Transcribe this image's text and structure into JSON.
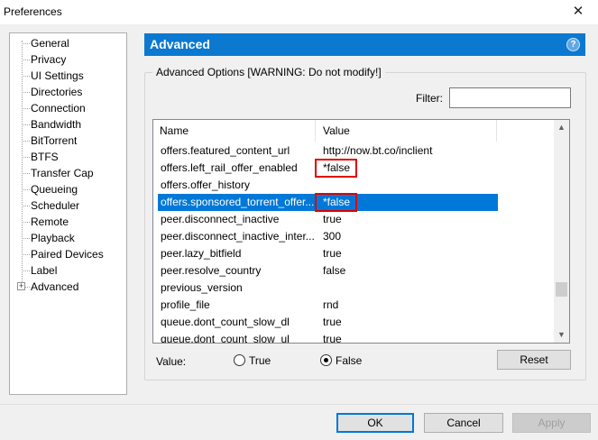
{
  "window": {
    "title": "Preferences",
    "close_glyph": "✕"
  },
  "sidebar": {
    "items": [
      {
        "label": "General"
      },
      {
        "label": "Privacy"
      },
      {
        "label": "UI Settings"
      },
      {
        "label": "Directories"
      },
      {
        "label": "Connection"
      },
      {
        "label": "Bandwidth"
      },
      {
        "label": "BitTorrent"
      },
      {
        "label": "BTFS"
      },
      {
        "label": "Transfer Cap"
      },
      {
        "label": "Queueing"
      },
      {
        "label": "Scheduler"
      },
      {
        "label": "Remote"
      },
      {
        "label": "Playback"
      },
      {
        "label": "Paired Devices"
      },
      {
        "label": "Label"
      },
      {
        "label": "Advanced",
        "expander": "+"
      }
    ]
  },
  "panel": {
    "title": "Advanced",
    "help_glyph": "?",
    "group_label": "Advanced Options [WARNING: Do not modify!]",
    "filter_label": "Filter:",
    "filter_value": ""
  },
  "list": {
    "columns": [
      "Name",
      "Value"
    ],
    "rows": [
      {
        "name": "offers.featured_content_url",
        "value": "http://now.bt.co/inclient"
      },
      {
        "name": "offers.left_rail_offer_enabled",
        "value": "*false",
        "highlighted": true
      },
      {
        "name": "offers.offer_history",
        "value": ""
      },
      {
        "name": "offers.sponsored_torrent_offer...",
        "value": "*false",
        "selected": true,
        "highlighted": true
      },
      {
        "name": "peer.disconnect_inactive",
        "value": "true"
      },
      {
        "name": "peer.disconnect_inactive_inter...",
        "value": "300"
      },
      {
        "name": "peer.lazy_bitfield",
        "value": "true"
      },
      {
        "name": "peer.resolve_country",
        "value": "false"
      },
      {
        "name": "previous_version",
        "value": ""
      },
      {
        "name": "profile_file",
        "value": "rnd"
      },
      {
        "name": "queue.dont_count_slow_dl",
        "value": "true"
      },
      {
        "name": "queue.dont_count_slow_ul",
        "value": "true"
      }
    ],
    "scroll_up_glyph": "▲",
    "scroll_down_glyph": "▼"
  },
  "value_editor": {
    "label": "Value:",
    "options": [
      "True",
      "False"
    ],
    "selected": "False",
    "reset_label": "Reset"
  },
  "footer": {
    "ok_label": "OK",
    "cancel_label": "Cancel",
    "apply_label": "Apply",
    "apply_enabled": false
  },
  "colors": {
    "header_bg": "#0b79d0",
    "selection_bg": "#0078d7",
    "highlight_border": "#e00000"
  }
}
